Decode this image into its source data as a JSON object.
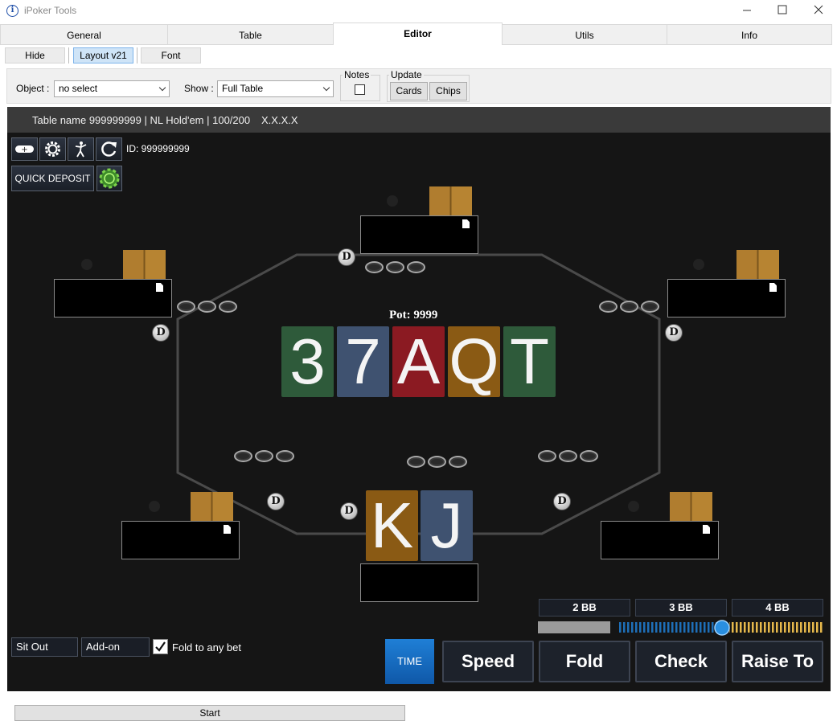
{
  "window": {
    "title": "iPoker Tools",
    "controls": [
      "—",
      "☐",
      "✕"
    ]
  },
  "tabs": [
    "General",
    "Table",
    "Editor",
    "Utils",
    "Info"
  ],
  "active_tab": "Editor",
  "subtabs": [
    "Hide",
    "Layout v21",
    "Font"
  ],
  "active_subtab": "Layout v21",
  "toolbar": {
    "object_label": "Object :",
    "object_value": "no select",
    "show_label": "Show :",
    "show_value": "Full Table",
    "notes_label": "Notes",
    "update_label": "Update",
    "cards_button": "Cards",
    "chips_button": "Chips"
  },
  "table": {
    "header_text": "Table name 999999999 | NL Hold'em | 100/200",
    "header_version": "X.X.X.X",
    "id_text": "ID: 999999999",
    "quick_deposit": "QUICK DEPOSIT",
    "pot_text": "Pot: 9999",
    "dealer_label": "D",
    "board_cards": [
      {
        "rank": "3",
        "color": "#2e5a3a"
      },
      {
        "rank": "7",
        "color": "#3f5270"
      },
      {
        "rank": "A",
        "color": "#8b1a22"
      },
      {
        "rank": "Q",
        "color": "#8a5a14"
      },
      {
        "rank": "T",
        "color": "#2e5a3a"
      }
    ],
    "hero_cards": [
      {
        "rank": "K",
        "color": "#8a5a14"
      },
      {
        "rank": "J",
        "color": "#3f5270"
      }
    ],
    "bet_presets": [
      "2 BB",
      "3 BB",
      "4 BB"
    ],
    "sit_out": "Sit Out",
    "add_on": "Add-on",
    "fold_to_any_bet": "Fold to any bet",
    "fold_to_any_checked": true,
    "time_button": "TIME",
    "actions": [
      "Speed",
      "Fold",
      "Check",
      "Raise To"
    ]
  },
  "bottom": {
    "start_button": "Start"
  },
  "icons": [
    "info-icon",
    "toggle-icon",
    "gear-icon",
    "figure-icon",
    "refresh-icon",
    "chip-icon",
    "note-icon",
    "checkbox-icon",
    "chevron-down-icon"
  ],
  "colors": {
    "accent": "#1a6bc4",
    "table_bg": "#151515",
    "header_bg": "#3a3a3a"
  }
}
